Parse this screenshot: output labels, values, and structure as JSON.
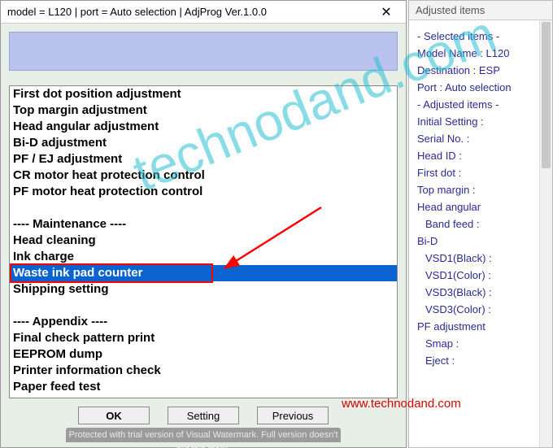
{
  "window": {
    "title": "model = L120 | port = Auto selection | AdjProg Ver.1.0.0",
    "close": "✕"
  },
  "listbox": {
    "items": [
      "First dot position adjustment",
      "Top margin adjustment",
      "Head angular adjustment",
      "Bi-D adjustment",
      "PF / EJ adjustment",
      "CR motor heat protection control",
      "PF motor heat protection control",
      "",
      "---- Maintenance ----",
      "Head cleaning",
      "Ink charge",
      "Waste ink pad counter",
      "Shipping setting",
      "",
      "---- Appendix ----",
      "Final check pattern print",
      "EEPROM dump",
      "Printer information check",
      "Paper feed test"
    ],
    "selected_index": 11
  },
  "buttons": {
    "ok": "OK",
    "setting": "Setting",
    "previous": "Previous"
  },
  "trial": "Protected with trial version of Visual Watermark. Full version doesn't put this mark.",
  "side": {
    "title": "Adjusted items",
    "header": "- Selected items -",
    "model": "Model Name : L120",
    "dest": "Destination : ESP",
    "port": "Port : Auto selection",
    "adjusted_header": "- Adjusted items -",
    "initial": "Initial Setting :",
    "serial": "Serial No. :",
    "headid": "Head ID :",
    "firstdot": "First dot :",
    "topmargin": "Top margin :",
    "headang": "Head angular",
    "bandfeed": "Band feed :",
    "bid": "Bi-D",
    "vsd1b": "VSD1(Black) :",
    "vsd1c": "VSD1(Color) :",
    "vsd3b": "VSD3(Black) :",
    "vsd3c": "VSD3(Color) :",
    "pfadj": "PF adjustment",
    "smap": "Smap :",
    "eject": "Eject :"
  },
  "watermark": "technodand.com",
  "url": "www.technodand.com"
}
